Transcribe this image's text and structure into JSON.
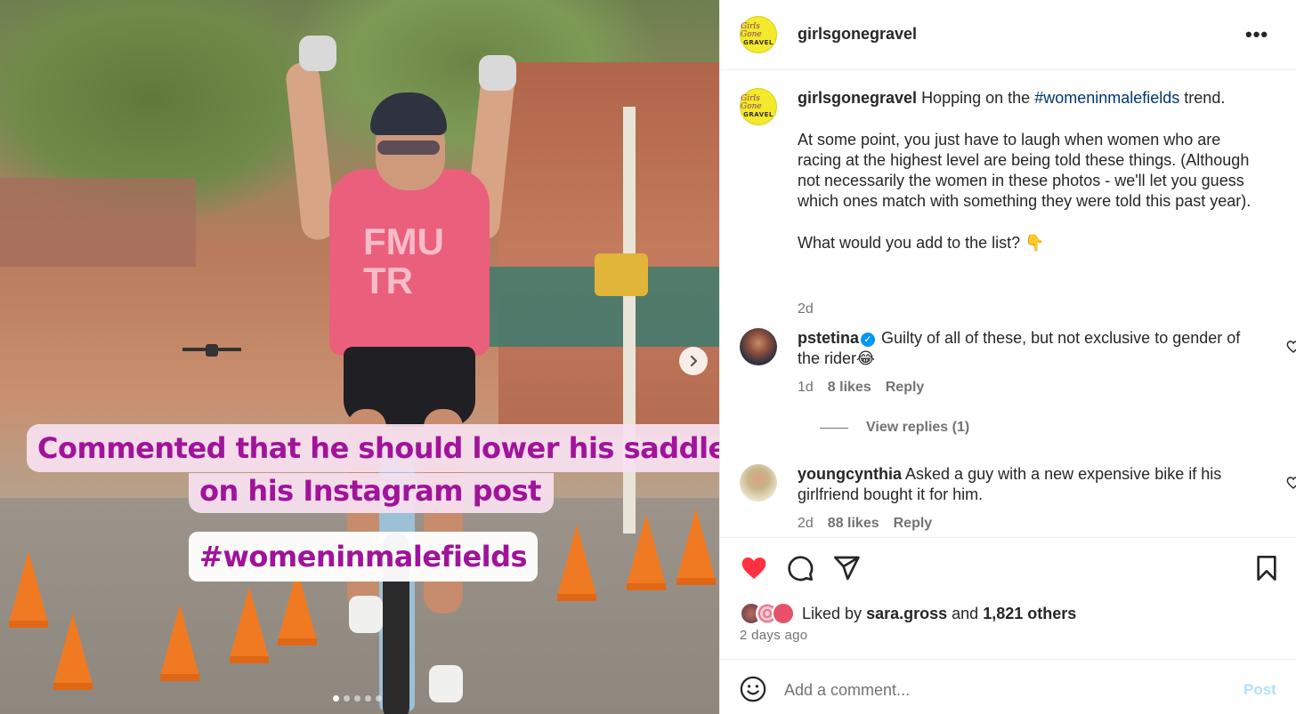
{
  "post": {
    "username": "girlsgonegravel",
    "more_label": "•••",
    "logo_text": {
      "line1": "Girls Gone",
      "line2": "GRAVEL"
    }
  },
  "photo": {
    "caption_line1": "Commented that he should lower his saddle",
    "caption_line2": "on his Instagram post",
    "caption_hashtag": "#womeninmalefields",
    "jersey_text": "FMU TR",
    "carousel": {
      "total": 5,
      "active": 1
    },
    "next_icon": "chevron-right-icon"
  },
  "caption": {
    "username": "girlsgonegravel",
    "lead": "Hopping on the",
    "hashtag": "#womeninmalefields",
    "lead_end": "trend.",
    "paragraph2": "At some point, you just have to laugh when women who are racing at the highest level are being told these things. (Although not necessarily the women in these photos - we'll let you guess which ones match with something they were told this past year).",
    "paragraph3": "What would you add to the list? 👇",
    "time": "2d"
  },
  "comments": [
    {
      "username": "pstetina",
      "verified": true,
      "text": "Guilty of all of these, but not exclusive to gender of the rider😂",
      "time": "1d",
      "likes": "8 likes",
      "reply_label": "Reply",
      "view_replies": "View replies (1)"
    },
    {
      "username": "youngcynthia",
      "verified": false,
      "text": "Asked a guy with a new expensive bike if his girlfriend bought it for him.",
      "time": "2d",
      "likes": "88 likes",
      "reply_label": "Reply"
    }
  ],
  "actions": {
    "icons": [
      "heart-filled-icon",
      "comment-icon",
      "share-icon",
      "bookmark-icon"
    ],
    "like_color": "#ff3040"
  },
  "likes": {
    "prefix": "Liked by",
    "user": "sara.gross",
    "and": "and",
    "others": "1,821 others"
  },
  "date": "2 days ago",
  "comment_box": {
    "placeholder": "Add a comment...",
    "post_label": "Post"
  }
}
